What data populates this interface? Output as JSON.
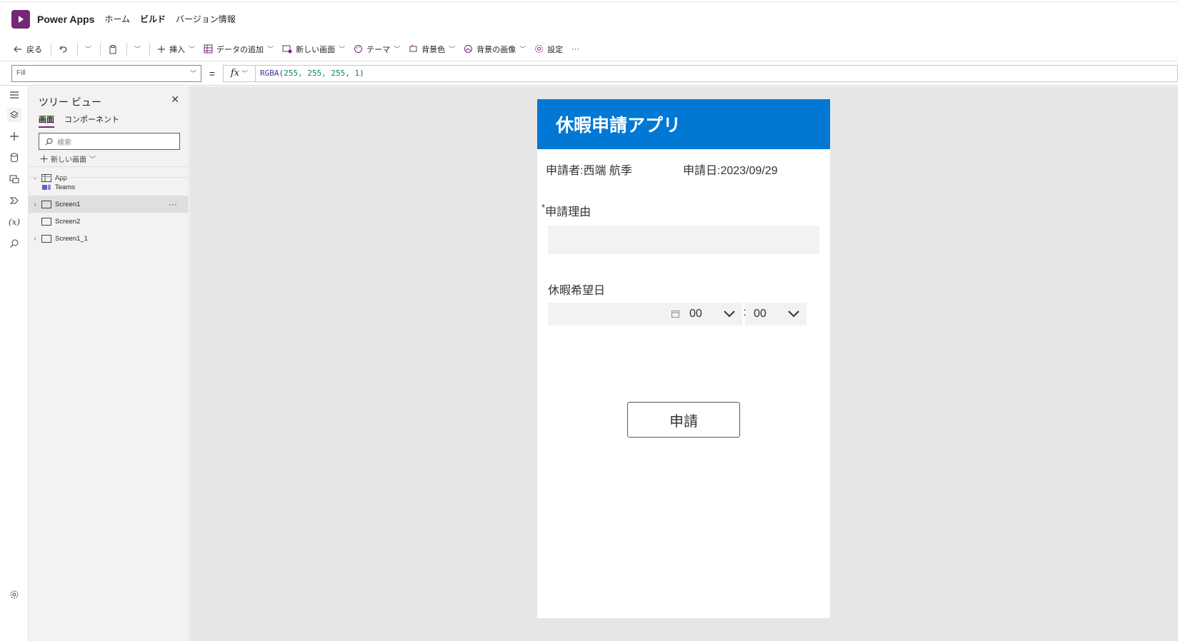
{
  "header": {
    "app_name": "Power Apps",
    "nav": [
      "ホーム",
      "ビルド",
      "バージョン情報"
    ]
  },
  "commandbar": {
    "back": "戻る",
    "insert": "挿入",
    "add_data": "データの追加",
    "new_screen": "新しい画面",
    "theme": "テーマ",
    "bg_color": "背景色",
    "bg_image": "背景の画像",
    "settings": "設定",
    "more": "···"
  },
  "formula_bar": {
    "property": "Fill",
    "equals": "=",
    "fx": "fx",
    "fn": "RGBA(",
    "args": "255, 255, 255, 1",
    "close": ")"
  },
  "tree_view": {
    "title": "ツリー ビュー",
    "tabs": [
      "画面",
      "コンポーネント"
    ],
    "search_placeholder": "検索",
    "new_screen": "新しい画面",
    "items": [
      "App",
      "Teams",
      "Screen1",
      "Screen2",
      "Screen1_1"
    ],
    "more": "···"
  },
  "app_screen": {
    "title": "休暇申請アプリ",
    "applicant": "申請者:西端 航季",
    "date": "申請日:2023/09/29",
    "required_mark": "*",
    "reason_label": "申請理由",
    "leave_date_label": "休暇希望日",
    "hour": "00",
    "minute": "00",
    "colon": ":",
    "submit": "申請"
  },
  "colors": {
    "brand": "#742774",
    "header_blue": "#0078d4",
    "canvas_bg": "#e6e6e6"
  }
}
